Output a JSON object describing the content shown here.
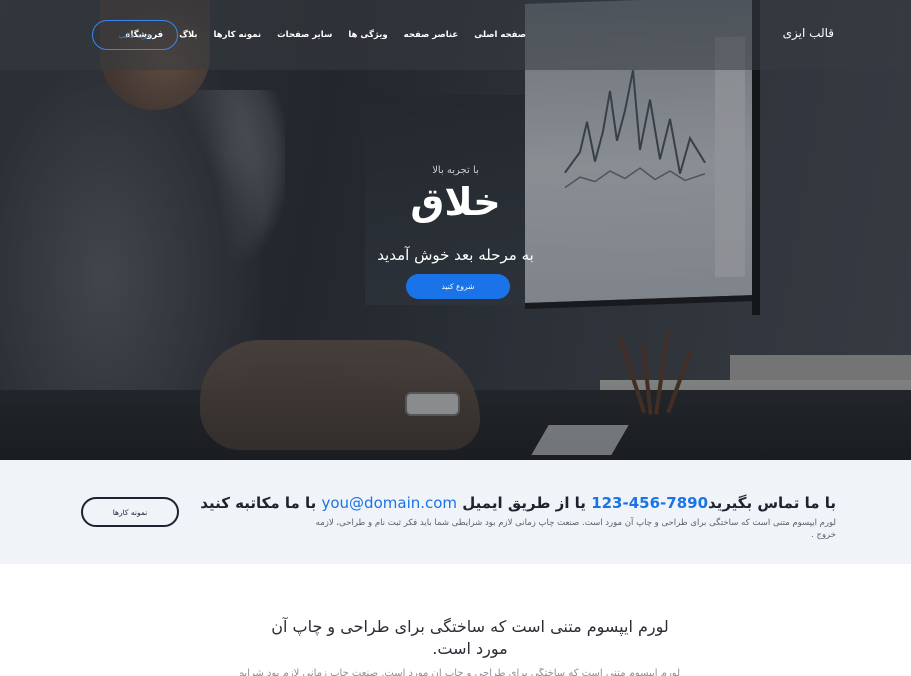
{
  "navbar": {
    "brand": "قالب ایزی",
    "menu": [
      {
        "label": "صفحه اصلی"
      },
      {
        "label": "عناصر صفحه"
      },
      {
        "label": "ویژگی ها"
      },
      {
        "label": "سایر صفحات"
      },
      {
        "label": "نمونه کارها"
      },
      {
        "label": "بلاگ"
      },
      {
        "label": "فروشگاه"
      }
    ],
    "buy_button": "خرید قالب"
  },
  "hero": {
    "eyebrow": "با تجربه بالا",
    "title": "خلاق",
    "subtitle": "به مرحله بعد خوش آمدید",
    "start_button": "شروع کنید"
  },
  "contact": {
    "heading_prefix": "با ما تماس بگیرید",
    "phone": "123-456-7890",
    "heading_middle": "یا از طریق ایمیل",
    "email": "you@domain.com",
    "heading_suffix": "با ما مکاتبه کنید",
    "description": "لورم ایپسوم متنی است که ساختگی برای طراحی و چاپ آن مورد است. صنعت چاپ زمانی لازم بود شرایطی شما باید فکر ثبت نام و طراحی، لازمه خروج .",
    "portfolio_button": "نمونه کارها"
  },
  "section": {
    "heading": "لورم ایپسوم متنی است که ساختگی برای طراحی و چاپ آن مورد است.",
    "text": "لورم ایپسوم متنی است که ساختگی برای طراحی و چاپ آن مورد است. صنعت چاپ زمانی لازم بود شرایطی شما"
  },
  "colors": {
    "accent": "#1a73e8",
    "contact_bg": "#f0f3f7",
    "dark_text": "#1d2330"
  }
}
